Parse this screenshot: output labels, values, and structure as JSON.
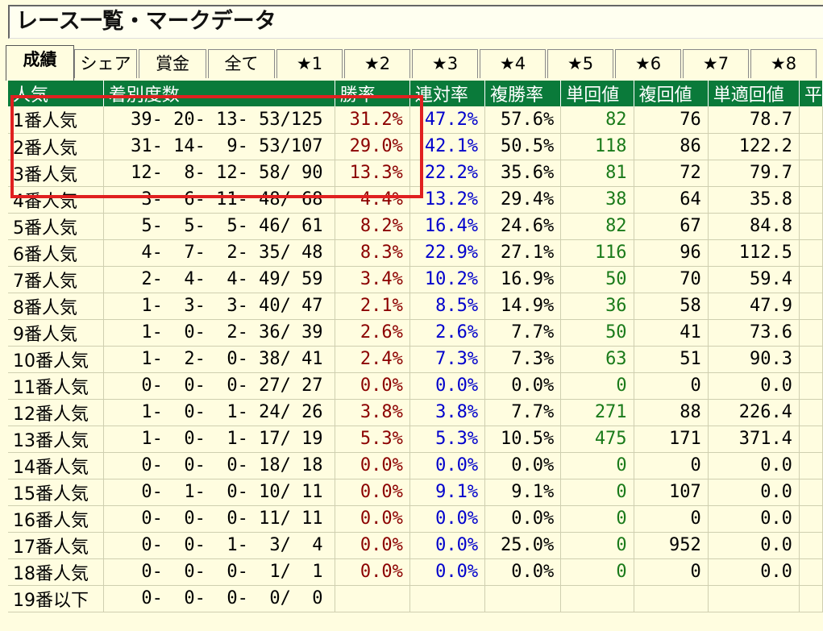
{
  "title": "レース一覧・マークデータ",
  "tabs": [
    "成績",
    "シェア",
    "賞金",
    "全て",
    "★1",
    "★2",
    "★3",
    "★4",
    "★5",
    "★6",
    "★7",
    "★8"
  ],
  "active_tab": 0,
  "columns": [
    "人気",
    "着別度数",
    "勝率",
    "連対率",
    "複勝率",
    "単回値",
    "複回値",
    "単適回値",
    "平"
  ],
  "rows": [
    {
      "name": "1番人気",
      "rec": "39- 20- 13- 53/125",
      "win": "31.2%",
      "ren": "47.2%",
      "fuku": "57.6%",
      "tan": "82",
      "fukv": "76",
      "adj": "78.7"
    },
    {
      "name": "2番人気",
      "rec": "31- 14-  9- 53/107",
      "win": "29.0%",
      "ren": "42.1%",
      "fuku": "50.5%",
      "tan": "118",
      "fukv": "86",
      "adj": "122.2"
    },
    {
      "name": "3番人気",
      "rec": "12-  8- 12- 58/ 90",
      "win": "13.3%",
      "ren": "22.2%",
      "fuku": "35.6%",
      "tan": "81",
      "fukv": "72",
      "adj": "79.7"
    },
    {
      "name": "4番人気",
      "rec": " 3-  6- 11- 48/ 68",
      "win": "4.4%",
      "ren": "13.2%",
      "fuku": "29.4%",
      "tan": "38",
      "fukv": "64",
      "adj": "35.8"
    },
    {
      "name": "5番人気",
      "rec": " 5-  5-  5- 46/ 61",
      "win": "8.2%",
      "ren": "16.4%",
      "fuku": "24.6%",
      "tan": "82",
      "fukv": "67",
      "adj": "84.8"
    },
    {
      "name": "6番人気",
      "rec": " 4-  7-  2- 35/ 48",
      "win": "8.3%",
      "ren": "22.9%",
      "fuku": "27.1%",
      "tan": "116",
      "fukv": "96",
      "adj": "112.5"
    },
    {
      "name": "7番人気",
      "rec": " 2-  4-  4- 49/ 59",
      "win": "3.4%",
      "ren": "10.2%",
      "fuku": "16.9%",
      "tan": "50",
      "fukv": "70",
      "adj": "59.4"
    },
    {
      "name": "8番人気",
      "rec": " 1-  3-  3- 40/ 47",
      "win": "2.1%",
      "ren": "8.5%",
      "fuku": "14.9%",
      "tan": "36",
      "fukv": "58",
      "adj": "47.9"
    },
    {
      "name": "9番人気",
      "rec": " 1-  0-  2- 36/ 39",
      "win": "2.6%",
      "ren": "2.6%",
      "fuku": "7.7%",
      "tan": "50",
      "fukv": "41",
      "adj": "73.6"
    },
    {
      "name": "10番人気",
      "rec": " 1-  2-  0- 38/ 41",
      "win": "2.4%",
      "ren": "7.3%",
      "fuku": "7.3%",
      "tan": "63",
      "fukv": "51",
      "adj": "90.3"
    },
    {
      "name": "11番人気",
      "rec": " 0-  0-  0- 27/ 27",
      "win": "0.0%",
      "ren": "0.0%",
      "fuku": "0.0%",
      "tan": "0",
      "fukv": "0",
      "adj": "0.0"
    },
    {
      "name": "12番人気",
      "rec": " 1-  0-  1- 24/ 26",
      "win": "3.8%",
      "ren": "3.8%",
      "fuku": "7.7%",
      "tan": "271",
      "fukv": "88",
      "adj": "226.4"
    },
    {
      "name": "13番人気",
      "rec": " 1-  0-  1- 17/ 19",
      "win": "5.3%",
      "ren": "5.3%",
      "fuku": "10.5%",
      "tan": "475",
      "fukv": "171",
      "adj": "371.4"
    },
    {
      "name": "14番人気",
      "rec": " 0-  0-  0- 18/ 18",
      "win": "0.0%",
      "ren": "0.0%",
      "fuku": "0.0%",
      "tan": "0",
      "fukv": "0",
      "adj": "0.0"
    },
    {
      "name": "15番人気",
      "rec": " 0-  1-  0- 10/ 11",
      "win": "0.0%",
      "ren": "9.1%",
      "fuku": "9.1%",
      "tan": "0",
      "fukv": "107",
      "adj": "0.0"
    },
    {
      "name": "16番人気",
      "rec": " 0-  0-  0- 11/ 11",
      "win": "0.0%",
      "ren": "0.0%",
      "fuku": "0.0%",
      "tan": "0",
      "fukv": "0",
      "adj": "0.0"
    },
    {
      "name": "17番人気",
      "rec": " 0-  0-  1-  3/  4",
      "win": "0.0%",
      "ren": "0.0%",
      "fuku": "25.0%",
      "tan": "0",
      "fukv": "952",
      "adj": "0.0"
    },
    {
      "name": "18番人気",
      "rec": " 0-  0-  0-  1/  1",
      "win": "0.0%",
      "ren": "0.0%",
      "fuku": "0.0%",
      "tan": "0",
      "fukv": "0",
      "adj": "0.0"
    },
    {
      "name": "19番以下",
      "rec": " 0-  0-  0-  0/  0",
      "win": "",
      "ren": "",
      "fuku": "",
      "tan": "",
      "fukv": "",
      "adj": ""
    }
  ],
  "colors": {
    "header_bg": "#0a7a3a",
    "win": "#8b0000",
    "ren": "#0000cc",
    "tan": "#1a7a1a",
    "highlight": "#e02020",
    "background": "#fffde0"
  }
}
